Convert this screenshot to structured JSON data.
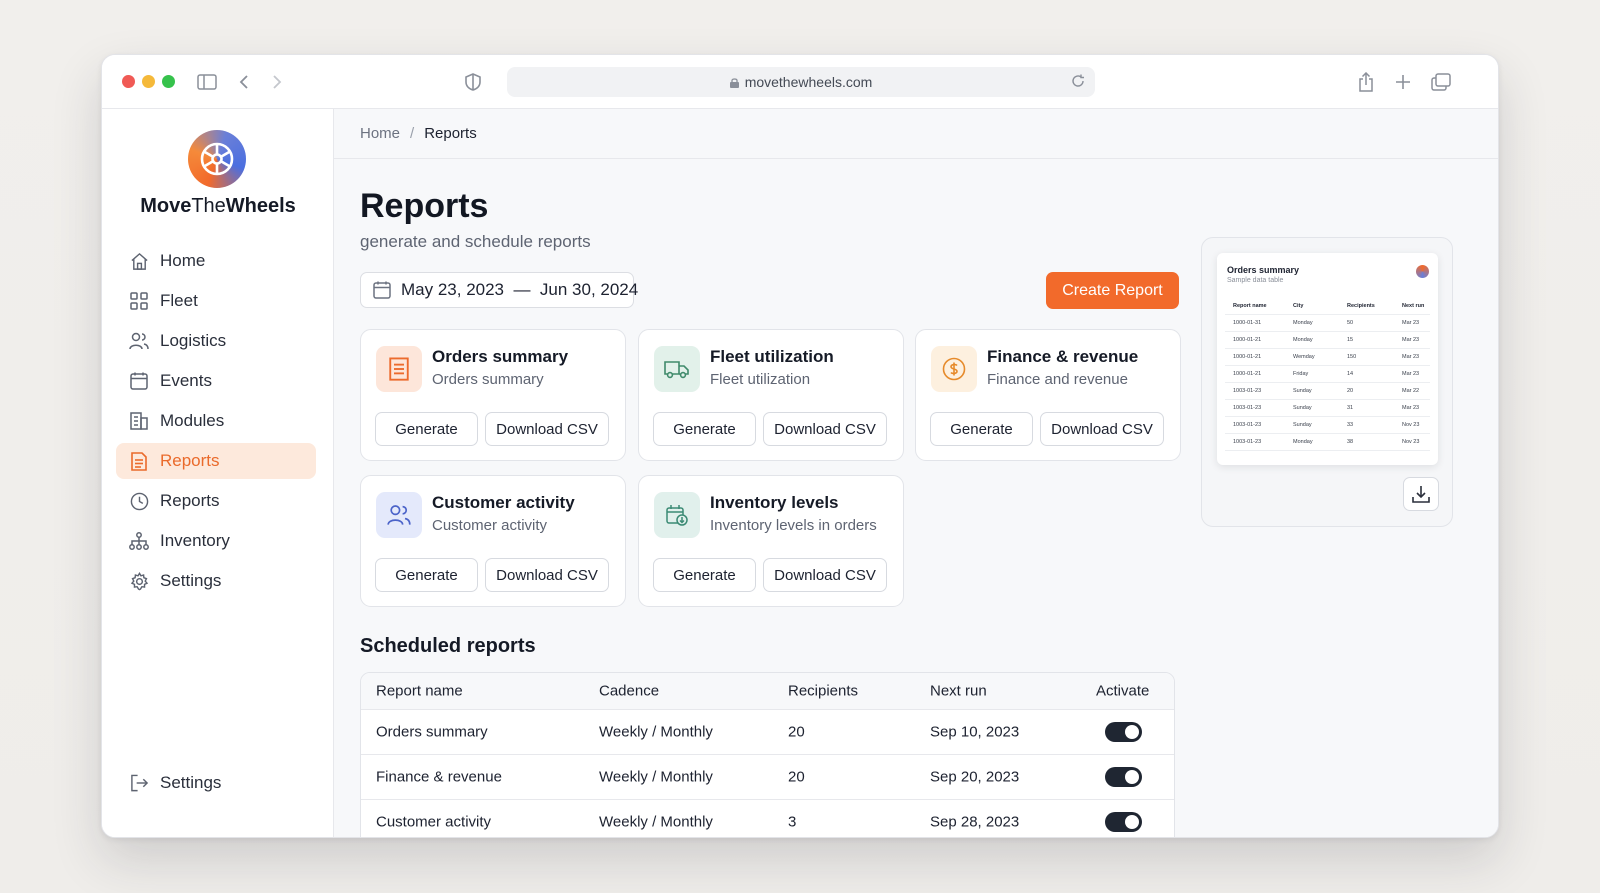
{
  "browser": {
    "url": "movethewheels.com"
  },
  "brand": {
    "name_bold": "Move",
    "name_light": "The",
    "name_bold2": "Wheels"
  },
  "sidebar": {
    "items": [
      {
        "label": "Home",
        "icon": "home-icon"
      },
      {
        "label": "Fleet",
        "icon": "grid-icon"
      },
      {
        "label": "Logistics",
        "icon": "users-icon"
      },
      {
        "label": "Events",
        "icon": "calendar-icon"
      },
      {
        "label": "Modules",
        "icon": "building-icon"
      },
      {
        "label": "Reports",
        "icon": "document-icon",
        "active": true
      },
      {
        "label": "Reports",
        "icon": "clock-icon"
      },
      {
        "label": "Inventory",
        "icon": "hierarchy-icon"
      },
      {
        "label": "Settings",
        "icon": "gear-icon"
      }
    ],
    "footer_label": "Settings"
  },
  "breadcrumb": {
    "home": "Home",
    "separator": "/",
    "current": "Reports"
  },
  "page": {
    "title": "Reports",
    "subtitle": "generate and schedule reports",
    "date_range": "May 23, 2023  —  Jun 30, 2024",
    "create_button": "Create Report"
  },
  "report_cards": [
    {
      "title": "Orders summary",
      "subtitle": "Orders summary",
      "generate": "Generate",
      "download": "Download CSV"
    },
    {
      "title": "Fleet utilization",
      "subtitle": "Fleet utilization",
      "generate": "Generate",
      "download": "Download CSV"
    },
    {
      "title": "Finance & revenue",
      "subtitle": "Finance and revenue",
      "generate": "Generate",
      "download": "Download CSV"
    },
    {
      "title": "Customer activity",
      "subtitle": "Customer activity",
      "generate": "Generate",
      "download": "Download CSV"
    },
    {
      "title": "Inventory levels",
      "subtitle": "Inventory levels in orders",
      "generate": "Generate",
      "download": "Download CSV"
    }
  ],
  "scheduled": {
    "title": "Scheduled reports",
    "headers": [
      "Report name",
      "Cadence",
      "Recipients",
      "Next run",
      "Activate"
    ],
    "rows": [
      {
        "name": "Orders summary",
        "cadence": "Weekly / Monthly",
        "recipients": "20",
        "next_run": "Sep 10, 2023",
        "active": true
      },
      {
        "name": "Finance & revenue",
        "cadence": "Weekly / Monthly",
        "recipients": "20",
        "next_run": "Sep 20, 2023",
        "active": true
      },
      {
        "name": "Customer activity",
        "cadence": "Weekly / Monthly",
        "recipients": "3",
        "next_run": "Sep 28, 2023",
        "active": true
      }
    ]
  },
  "preview": {
    "title": "Orders summary",
    "subtitle": "Sample data table",
    "headers": [
      "Report name",
      "City",
      "Recipients",
      "Next run"
    ],
    "rows": [
      [
        "1000-01-31",
        "Monday",
        "50",
        "Mar 23"
      ],
      [
        "1000-01-21",
        "Monday",
        "15",
        "Mar 23"
      ],
      [
        "1000-01-21",
        "Wemday",
        "150",
        "Mar 23"
      ],
      [
        "1000-01-21",
        "Friday",
        "14",
        "Mar 23"
      ],
      [
        "1003-01-23",
        "Sunday",
        "20",
        "Mar 22"
      ],
      [
        "1003-01-23",
        "Sunday",
        "31",
        "Mar 23"
      ],
      [
        "1003-01-23",
        "Sunday",
        "33",
        "Nov 23"
      ],
      [
        "1003-01-23",
        "Monday",
        "38",
        "Nov 23"
      ]
    ]
  },
  "colors": {
    "accent": "#f26a2b",
    "active_bg": "#fde9dc",
    "toggle_on": "#1f2632"
  }
}
